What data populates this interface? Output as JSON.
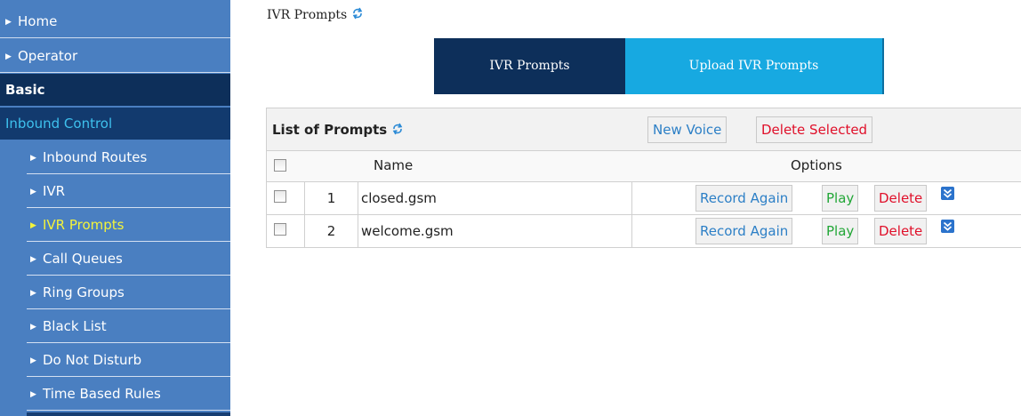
{
  "sidebar": {
    "items": [
      {
        "label": "Home"
      },
      {
        "label": "Operator"
      },
      {
        "label": "Basic"
      },
      {
        "label": "Inbound Control"
      },
      {
        "label": "Inbound Routes"
      },
      {
        "label": "IVR"
      },
      {
        "label": "IVR Prompts"
      },
      {
        "label": "Call Queues"
      },
      {
        "label": "Ring Groups"
      },
      {
        "label": "Black List"
      },
      {
        "label": "Do Not Disturb"
      },
      {
        "label": "Time Based Rules"
      }
    ]
  },
  "page": {
    "title": "IVR Prompts"
  },
  "tabs": [
    {
      "label": "IVR Prompts",
      "active": true
    },
    {
      "label": "Upload IVR Prompts",
      "active": false
    }
  ],
  "list": {
    "title": "List of Prompts",
    "new_voice": "New Voice",
    "delete_selected": "Delete Selected",
    "columns": {
      "name": "Name",
      "options": "Options"
    },
    "rows": [
      {
        "num": "1",
        "name": "closed.gsm"
      },
      {
        "num": "2",
        "name": "welcome.gsm"
      }
    ],
    "actions": {
      "record": "Record Again",
      "play": "Play",
      "delete": "Delete"
    }
  },
  "colors": {
    "sidebar_bg": "#4a7fc1",
    "sidebar_dark": "#0d2f5a",
    "accent_active": "#f4f43a",
    "tab_upload": "#17a9e1",
    "link_blue": "#2c7fc6",
    "delete_red": "#e0102a",
    "play_green": "#21a636"
  }
}
